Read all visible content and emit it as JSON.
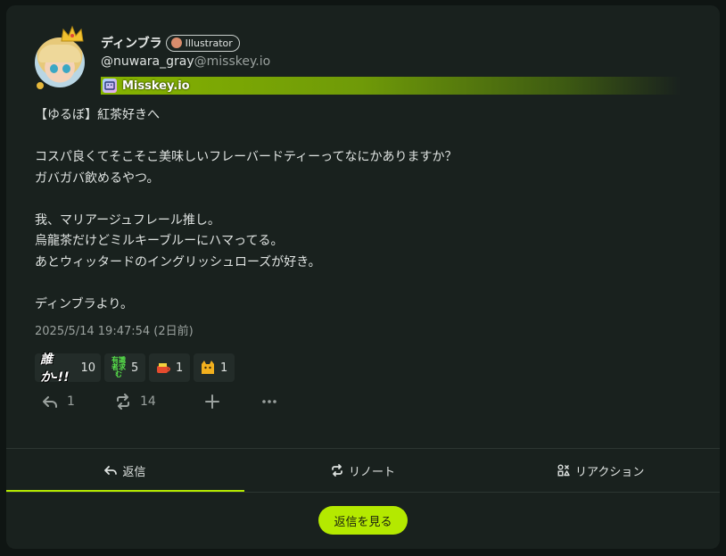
{
  "user": {
    "display_name": "ディンブラ",
    "role": "Illustrator",
    "username": "@nuwara_gray",
    "host": "@misskey.io",
    "instance_name": "Misskey.io"
  },
  "note": {
    "text": "【ゆるぼ】紅茶好きへ\n\nコスパ良くてそこそこ美味しいフレーバードティーってなにかありますか？\nガバガバ飲めるやつ。\n\n我、マリアージュフレール推し。\n烏龍茶だけどミルキーブルーにハマってる。\nあとウィッタードのイングリッシュローズが好き。\n\nディンブラより。",
    "timestamp": "2025/5/14 19:47:54 (2日前)"
  },
  "reactions": [
    {
      "label": "誰か‐!!",
      "count": "10"
    },
    {
      "label": "有識者求む",
      "count": "5"
    },
    {
      "label": "tea-emoji",
      "count": "1"
    },
    {
      "label": "cat-emoji",
      "count": "1"
    }
  ],
  "actions": {
    "reply_count": "1",
    "renote_count": "14"
  },
  "tabs": [
    {
      "label": "返信"
    },
    {
      "label": "リノート"
    },
    {
      "label": "リアクション"
    }
  ],
  "see_replies_label": "返信を見る",
  "colors": {
    "accent": "#b4e900",
    "card_bg": "#19211e",
    "instance_bar": "#86b300"
  }
}
